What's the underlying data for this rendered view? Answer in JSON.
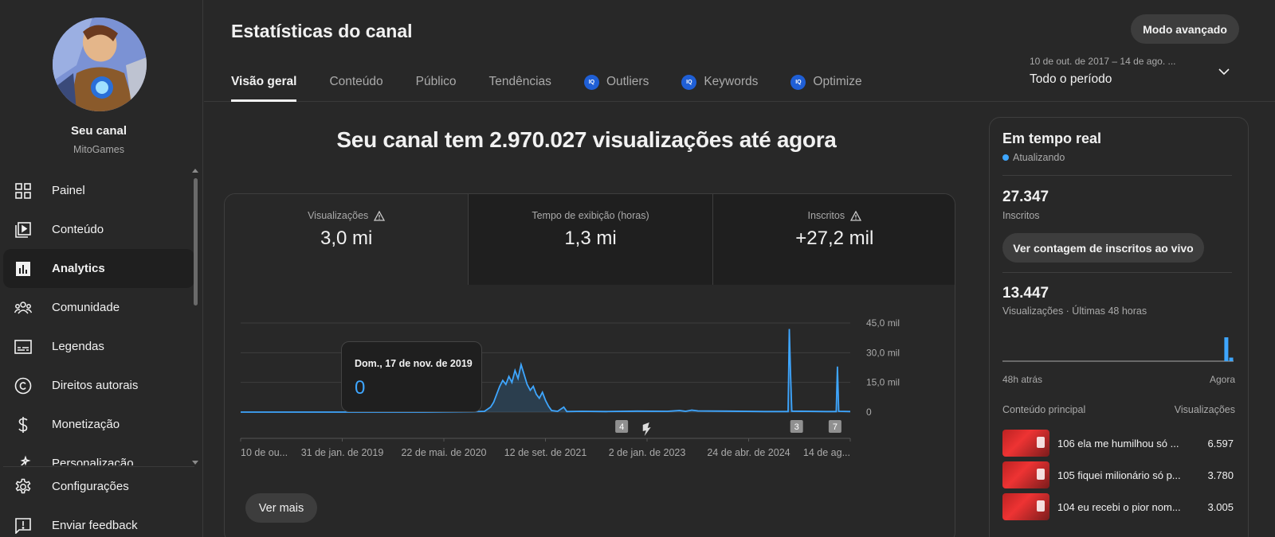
{
  "sidebar": {
    "channel_title": "Seu canal",
    "channel_name": "MitoGames",
    "items": [
      {
        "label": "Painel",
        "icon": "dashboard-icon"
      },
      {
        "label": "Conteúdo",
        "icon": "content-icon"
      },
      {
        "label": "Analytics",
        "icon": "analytics-icon",
        "active": true
      },
      {
        "label": "Comunidade",
        "icon": "community-icon"
      },
      {
        "label": "Legendas",
        "icon": "subtitles-icon"
      },
      {
        "label": "Direitos autorais",
        "icon": "copyright-icon"
      },
      {
        "label": "Monetização",
        "icon": "monetization-icon"
      },
      {
        "label": "Personalização",
        "icon": "customization-icon"
      }
    ],
    "bottom_items": [
      {
        "label": "Configurações",
        "icon": "gear-icon"
      },
      {
        "label": "Enviar feedback",
        "icon": "feedback-icon"
      }
    ]
  },
  "header": {
    "title": "Estatísticas do canal",
    "advanced_button": "Modo avançado",
    "tabs": [
      {
        "label": "Visão geral",
        "active": true
      },
      {
        "label": "Conteúdo"
      },
      {
        "label": "Público"
      },
      {
        "label": "Tendências"
      },
      {
        "label": "Outliers",
        "badge": "IQ"
      },
      {
        "label": "Keywords",
        "badge": "IQ"
      },
      {
        "label": "Optimize",
        "badge": "IQ"
      }
    ],
    "period_range": "10 de out. de 2017 – 14 de ago. ...",
    "period_value": "Todo o período"
  },
  "main": {
    "headline": "Seu canal tem 2.970.027 visualizações até agora",
    "metrics": [
      {
        "label": "Visualizações",
        "value": "3,0 mi",
        "warning": true
      },
      {
        "label": "Tempo de exibição (horas)",
        "value": "1,3 mi",
        "warning": false
      },
      {
        "label": "Inscritos",
        "value": "+27,2 mil",
        "warning": true
      }
    ],
    "tooltip": {
      "date": "Dom., 17 de nov. de 2019",
      "value": "0"
    },
    "more_button": "Ver mais"
  },
  "chart_data": {
    "type": "area",
    "x_tick_labels": [
      "10 de ou...",
      "31 de jan. de 2019",
      "22 de mai. de 2020",
      "12 de set. de 2021",
      "2 de jan. de 2023",
      "24 de abr. de 2024",
      "14 de ag..."
    ],
    "y_tick_labels": [
      "0",
      "15,0 mil",
      "30,0 mil",
      "45,0 mil"
    ],
    "ylim": [
      0,
      45000
    ],
    "series": [
      {
        "color": "#3ea6ff",
        "points": [
          [
            0,
            0
          ],
          [
            0.3,
            0
          ],
          [
            0.38,
            200
          ],
          [
            0.4,
            400
          ],
          [
            0.41,
            2500
          ],
          [
            0.415,
            5000
          ],
          [
            0.42,
            9000
          ],
          [
            0.425,
            13000
          ],
          [
            0.43,
            16000
          ],
          [
            0.435,
            14000
          ],
          [
            0.44,
            18000
          ],
          [
            0.445,
            15000
          ],
          [
            0.45,
            21000
          ],
          [
            0.455,
            17000
          ],
          [
            0.46,
            24000
          ],
          [
            0.465,
            19000
          ],
          [
            0.47,
            14000
          ],
          [
            0.475,
            11000
          ],
          [
            0.48,
            13000
          ],
          [
            0.485,
            9000
          ],
          [
            0.49,
            7000
          ],
          [
            0.495,
            10000
          ],
          [
            0.5,
            6000
          ],
          [
            0.505,
            3000
          ],
          [
            0.51,
            800
          ],
          [
            0.52,
            400
          ],
          [
            0.53,
            2500
          ],
          [
            0.535,
            300
          ],
          [
            0.56,
            400
          ],
          [
            0.6,
            300
          ],
          [
            0.65,
            500
          ],
          [
            0.7,
            400
          ],
          [
            0.72,
            800
          ],
          [
            0.73,
            400
          ],
          [
            0.74,
            1000
          ],
          [
            0.75,
            600
          ],
          [
            0.8,
            500
          ],
          [
            0.86,
            300
          ],
          [
            0.898,
            300
          ],
          [
            0.9,
            42000
          ],
          [
            0.902,
            20000
          ],
          [
            0.904,
            500
          ],
          [
            0.96,
            300
          ],
          [
            0.977,
            300
          ],
          [
            0.979,
            23000
          ],
          [
            0.981,
            400
          ],
          [
            1,
            300
          ]
        ]
      }
    ],
    "markers": [
      {
        "label": "4"
      },
      {
        "label": "shorts"
      },
      {
        "label": "3"
      },
      {
        "label": "7"
      }
    ]
  },
  "realtime": {
    "title": "Em tempo real",
    "status": "Atualizando",
    "subscribers": "27.347",
    "subscribers_label": "Inscritos",
    "live_button": "Ver contagem de inscritos ao vivo",
    "views": "13.447",
    "views_label": "Visualizações · Últimas 48 horas",
    "axis_left": "48h atrás",
    "axis_right": "Agora",
    "content_header": "Conteúdo principal",
    "views_header": "Visualizações",
    "mini_bars": [
      0,
      0,
      0,
      0,
      0,
      0,
      0,
      0,
      0,
      0,
      0,
      0,
      0,
      0,
      0,
      0,
      0,
      0,
      0,
      0,
      0,
      0,
      0,
      0,
      0,
      0,
      0,
      0,
      0,
      0,
      0,
      0,
      0,
      0,
      0,
      0,
      0,
      0,
      0,
      0,
      0,
      0,
      0,
      0,
      0,
      0,
      1.0,
      0.15
    ],
    "top_content": [
      {
        "title": "106 ela me humilhou só ...",
        "views": "6.597"
      },
      {
        "title": "105 fiquei milionário só p...",
        "views": "3.780"
      },
      {
        "title": "104 eu recebi o pior nom...",
        "views": "3.005"
      }
    ]
  },
  "colors": {
    "accent": "#3ea6ff",
    "background": "#282828",
    "panel": "#1f1f1f",
    "iq_badge": "#1f5fd6"
  }
}
